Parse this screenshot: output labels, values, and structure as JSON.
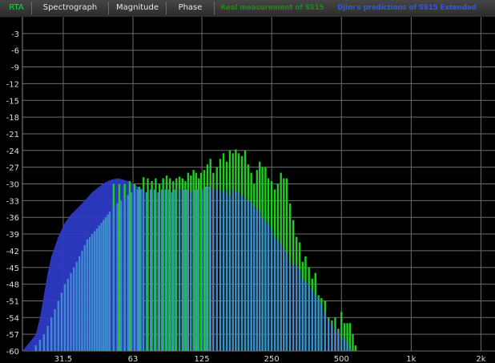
{
  "tabs": [
    {
      "label": "RTA",
      "active": true
    },
    {
      "label": "Spectrograph",
      "active": false
    },
    {
      "label": "Magnitude",
      "active": false
    },
    {
      "label": "Phase",
      "active": false
    }
  ],
  "legend": [
    {
      "label": "Real measurement of SS15",
      "color": "#22aa22"
    },
    {
      "label": "Djim's predictions of SS15 Extended",
      "color": "#3366ff"
    }
  ],
  "chart_data": {
    "type": "bar",
    "xscale": "log",
    "x_ticks": [
      "31.5",
      "63",
      "125",
      "250",
      "500",
      "1k",
      "2k"
    ],
    "x_tick_values": [
      31.5,
      63,
      125,
      250,
      500,
      1000,
      2000
    ],
    "y_ticks": [
      "-3",
      "-6",
      "-9",
      "-12",
      "-15",
      "-18",
      "-21",
      "-24",
      "-27",
      "-30",
      "-33",
      "-36",
      "-39",
      "-42",
      "-45",
      "-48",
      "-51",
      "-54",
      "-57",
      "-60"
    ],
    "ylim": [
      -60,
      0
    ],
    "xlim": [
      21,
      2300
    ],
    "grid": true,
    "series": [
      {
        "name": "Real measurement of SS15",
        "color": "#1fcc22",
        "x": [
          52,
          55,
          58,
          61,
          64,
          67,
          70,
          73,
          76,
          79,
          82,
          85,
          88,
          91,
          94,
          97,
          100,
          103,
          106,
          109,
          112,
          115,
          118,
          121,
          124,
          128,
          132,
          136,
          140,
          145,
          150,
          155,
          160,
          165,
          170,
          175,
          180,
          186,
          192,
          198,
          204,
          210,
          216,
          222,
          228,
          235,
          242,
          250,
          258,
          266,
          274,
          282,
          290,
          300,
          310,
          320,
          330,
          340,
          350,
          362,
          374,
          386,
          398,
          410,
          425,
          440,
          455,
          470,
          485,
          500,
          515,
          530,
          545,
          560,
          575
        ],
        "values": [
          -30,
          -30,
          -30,
          -29.5,
          -30,
          -30.5,
          -28.8,
          -29,
          -29.5,
          -29,
          -30,
          -29,
          -28.5,
          -29,
          -29.5,
          -29,
          -28.7,
          -29,
          -29.5,
          -28,
          -28.5,
          -27.5,
          -28,
          -29,
          -28,
          -27.5,
          -26.5,
          -25.5,
          -28,
          -27,
          -25.5,
          -24.5,
          -26,
          -24,
          -24.5,
          -23.8,
          -24.5,
          -25,
          -24,
          -26.5,
          -28,
          -30,
          -27.5,
          -26,
          -27,
          -27,
          -29,
          -29.5,
          -31,
          -30,
          -28,
          -29,
          -29,
          -33.5,
          -36.5,
          -39.5,
          -40.5,
          -44,
          -43,
          -45,
          -47,
          -46,
          -50,
          -50.5,
          -51,
          -54,
          -54.5,
          -54,
          -56,
          -53,
          -55,
          -55,
          -55,
          -57,
          -59
        ]
      },
      {
        "name": "Djim's predictions of SS15 Extended",
        "color": "#2d3ac4",
        "x": [
          21,
          22,
          23,
          24,
          25,
          26,
          27,
          28,
          30,
          32,
          34,
          36,
          38,
          40,
          42,
          45,
          48,
          51,
          54,
          57,
          60,
          63,
          66,
          70
        ],
        "values": [
          -60,
          -59,
          -58,
          -57,
          -54,
          -50,
          -46,
          -43,
          -39.5,
          -37,
          -35.5,
          -34.5,
          -33.5,
          -32.5,
          -31.5,
          -30.5,
          -29.7,
          -29.2,
          -29,
          -29.2,
          -29.5,
          -30,
          -30.5,
          -31
        ]
      },
      {
        "name": "",
        "color": "#3d8acc",
        "x": [
          24,
          25,
          26,
          27,
          28,
          29,
          30,
          31,
          32,
          33,
          34,
          35,
          36,
          37,
          38,
          39,
          40,
          41,
          42,
          43,
          44,
          45,
          46,
          47,
          48,
          49,
          50,
          52,
          54,
          56,
          58,
          60,
          62,
          64,
          66,
          68,
          70,
          72,
          75,
          78,
          81,
          84,
          87,
          90,
          93,
          96,
          100,
          104,
          108,
          112,
          116,
          120,
          125,
          130,
          135,
          140,
          145,
          150,
          155,
          160,
          165,
          170,
          175,
          180,
          186,
          192,
          198,
          204,
          210,
          216,
          222,
          228,
          235,
          242,
          250,
          258,
          266,
          274,
          282,
          290,
          300,
          310,
          320,
          330,
          340,
          350,
          362,
          374,
          386,
          398,
          410,
          425,
          440,
          455,
          470,
          485,
          500,
          515,
          530,
          545,
          560
        ],
        "values": [
          -59,
          -58,
          -57,
          -55.5,
          -54,
          -52.5,
          -51,
          -49.5,
          -48,
          -47,
          -46,
          -45,
          -44,
          -43,
          -42,
          -41,
          -40,
          -39.5,
          -39,
          -38.5,
          -38,
          -37.5,
          -37,
          -36.5,
          -36,
          -35.5,
          -35,
          -34,
          -33.5,
          -33,
          -32.5,
          -32,
          -31.5,
          -31,
          -31,
          -31,
          -31,
          -31.5,
          -31,
          -31,
          -31.5,
          -31,
          -31,
          -31,
          -31.5,
          -31,
          -31,
          -31,
          -31,
          -31.5,
          -31,
          -31,
          -31,
          -30.5,
          -30.5,
          -31,
          -31,
          -31,
          -31.5,
          -31,
          -32,
          -31,
          -31.5,
          -31.5,
          -32,
          -32.5,
          -33,
          -33,
          -34,
          -34.5,
          -35,
          -36,
          -36.5,
          -37,
          -38,
          -39.5,
          -40,
          -40.5,
          -41.5,
          -42.5,
          -44,
          -44.5,
          -44.5,
          -45.5,
          -47,
          -47.5,
          -48,
          -49,
          -50,
          -50.5,
          -51.5,
          -53,
          -54.5,
          -55,
          -56,
          -56.5,
          -58,
          -57.5,
          -58.5,
          -59.5,
          -60
        ]
      }
    ]
  }
}
